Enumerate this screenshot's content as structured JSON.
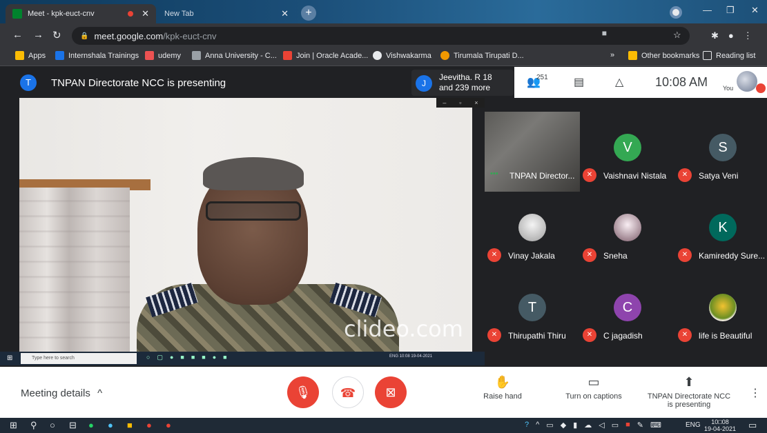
{
  "browser": {
    "tabs": [
      {
        "title": "Meet - kpk-euct-cnv",
        "active": true
      },
      {
        "title": "New Tab",
        "active": false
      }
    ],
    "new_tab_symbol": "+",
    "url_domain": "meet.google.com",
    "url_path": "/kpk-euct-cnv",
    "bookmarks": [
      {
        "label": "Apps",
        "icon": "apps-grid-icon",
        "color": "#fbbc04"
      },
      {
        "label": "Internshala Trainings",
        "icon": "internshala-icon",
        "color": "#1a73e8"
      },
      {
        "label": "udemy",
        "icon": "udemy-icon",
        "color": "#ec5252"
      },
      {
        "label": "Anna University - C...",
        "icon": "anna-university-icon",
        "color": "#9aa0a6"
      },
      {
        "label": "Join | Oracle Acade...",
        "icon": "oracle-icon",
        "color": "#ea4335"
      },
      {
        "label": "Vishwakarma",
        "icon": "globe-icon",
        "color": "#e8eaed"
      },
      {
        "label": "Tirumala Tirupati D...",
        "icon": "ttd-icon",
        "color": "#f29900"
      }
    ],
    "bookmarks_overflow": "»",
    "other_bookmarks": "Other bookmarks",
    "reading_list": "Reading list"
  },
  "meet": {
    "presenter_initial": "T",
    "presenter_banner": "TNPAN Directorate NCC is presenting",
    "joiner": {
      "initial": "J",
      "line1": "Jeevitha. R 18",
      "line2": "and 239 more"
    },
    "people_count": "251",
    "clock": "10:08 AM",
    "you_label": "You",
    "mini_window": {
      "minimize": "–",
      "restore": "▫",
      "close": "×"
    },
    "watermark": "clideo.com",
    "inner_taskbar": {
      "search_placeholder": "Type here to search",
      "lang": "ENG",
      "time": "10:08",
      "date": "19-04-2021"
    },
    "participants": [
      {
        "name": "TNPAN Director...",
        "type": "video",
        "color": "#6c6a66"
      },
      {
        "name": "Vaishnavi Nistala",
        "initial": "V",
        "color": "#34a853"
      },
      {
        "name": "Satya Veni",
        "initial": "S",
        "color": "#455a64"
      },
      {
        "name": "Vinay Jakala",
        "initial": "",
        "color": "#bfbfbf"
      },
      {
        "name": "Sneha",
        "initial": "",
        "color": "#e6d9e0"
      },
      {
        "name": "Kamireddy Sure...",
        "initial": "K",
        "color": "#00695c"
      },
      {
        "name": "Thirupathi Thiru",
        "initial": "T",
        "color": "#455a64"
      },
      {
        "name": "C jagadish",
        "initial": "C",
        "color": "#8e44ad"
      },
      {
        "name": "life is Beautiful",
        "initial": "",
        "color": "#f5efe4"
      }
    ],
    "controls": {
      "meeting_details": "Meeting details",
      "raise_hand": "Raise hand",
      "captions": "Turn on captions",
      "presenting_line1": "TNPAN Directorate NCC",
      "presenting_line2": "is presenting"
    }
  },
  "taskbar": {
    "lang": "ENG",
    "time": "10□08",
    "date": "19-04-2021"
  }
}
